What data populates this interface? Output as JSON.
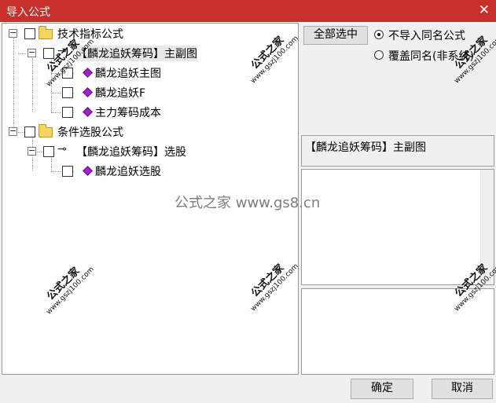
{
  "window": {
    "title": "导入公式",
    "close_glyph": "✕"
  },
  "tree": {
    "nodes": [
      {
        "label": "技术指标公式",
        "icon": "folder-icon",
        "expander": "−"
      },
      {
        "label": "【麟龙追妖筹码】主副图",
        "icon": "key-icon",
        "expander": "−",
        "selected": true
      },
      {
        "label": "麟龙追妖主图",
        "icon": "formula-gem-icon"
      },
      {
        "label": "麟龙追妖F",
        "icon": "formula-gem-icon"
      },
      {
        "label": "主力筹码成本",
        "icon": "formula-gem-icon"
      },
      {
        "label": "条件选股公式",
        "icon": "folder-icon",
        "expander": "−"
      },
      {
        "label": "【麟龙追妖筹码】选股",
        "icon": "key-icon",
        "expander": "−"
      },
      {
        "label": "麟龙追妖选股",
        "icon": "formula-gem-icon"
      }
    ],
    "key_glyph": "⊸"
  },
  "right": {
    "select_all_label": "全部选中",
    "radio_options": [
      {
        "label": "不导入同名公式",
        "checked": true
      },
      {
        "label": "覆盖同名(非系统)",
        "checked": false
      }
    ],
    "info_text": "【麟龙追妖筹码】主副图"
  },
  "center_mark": "公式之家 www.gs8.cn",
  "watermark": {
    "line1": "公式之家",
    "line2": "www.gszj100.com"
  },
  "footer": {
    "ok_label": "确定",
    "cancel_label": "取消"
  },
  "colors": {
    "titlebar": "#c8302c",
    "gem": "#a51fcf",
    "folder": "#f5d45e"
  }
}
